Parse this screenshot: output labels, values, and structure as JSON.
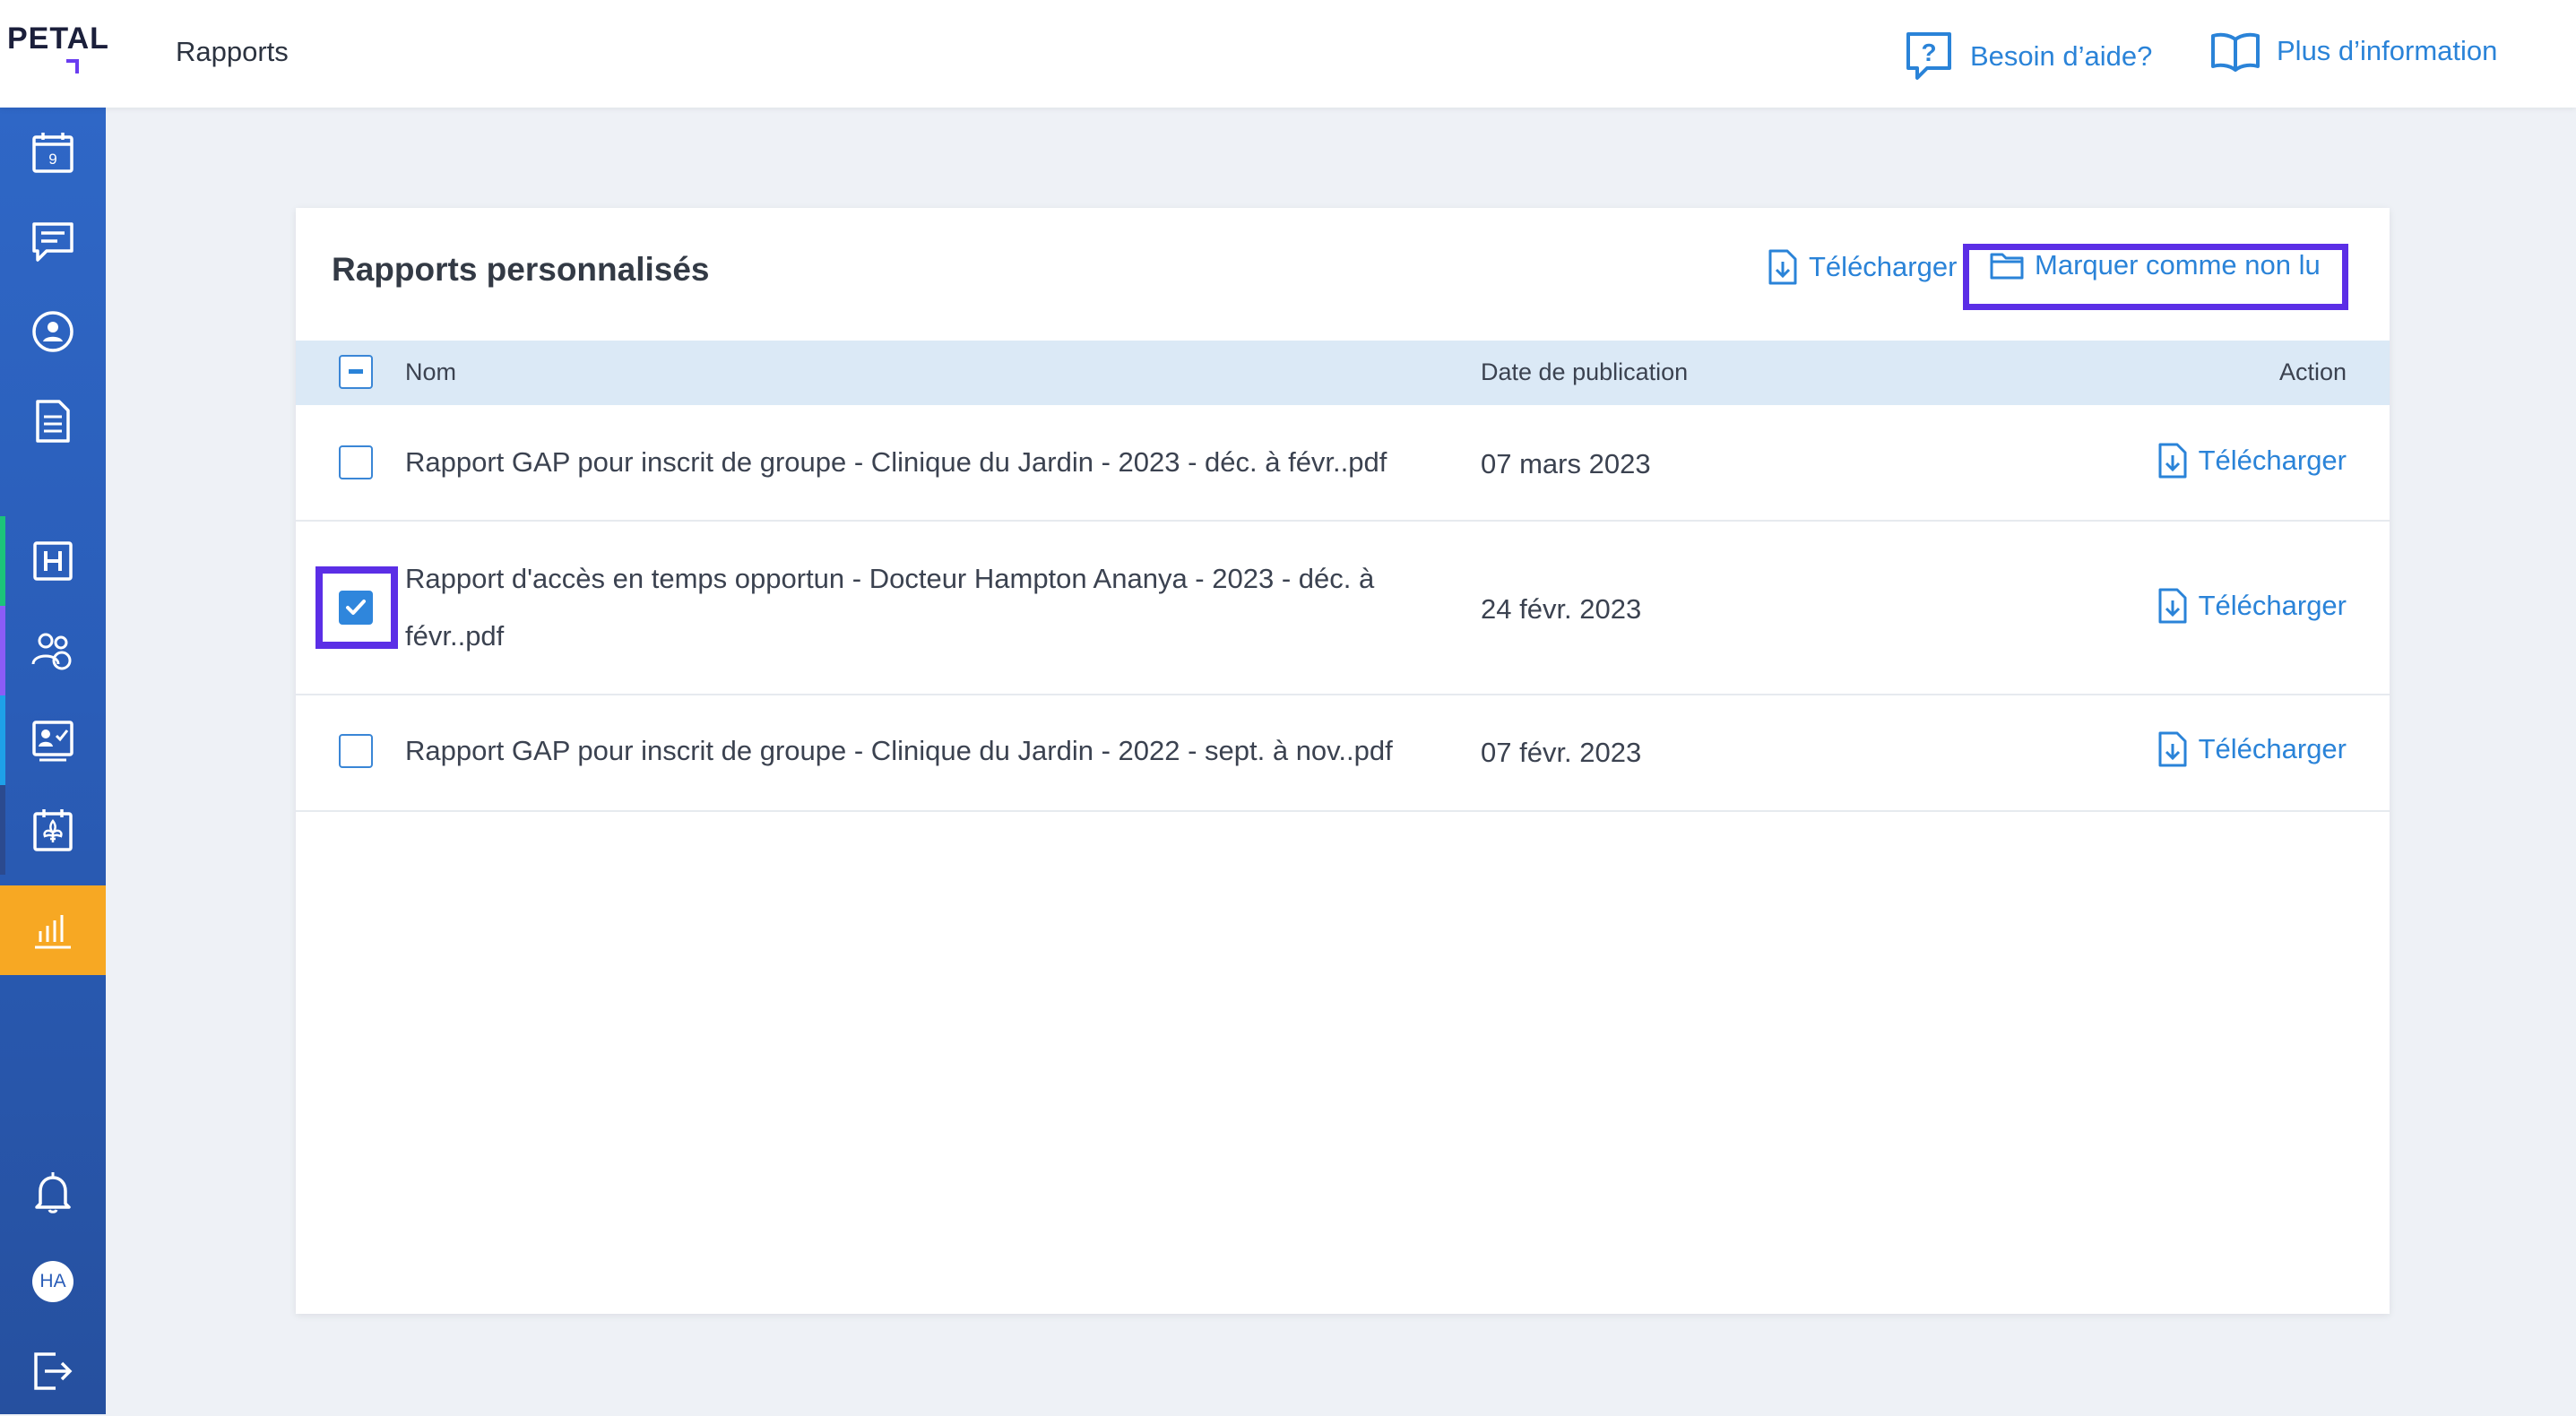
{
  "brand": {
    "logo_text": "PETAL"
  },
  "header": {
    "title": "Rapports",
    "help_label": "Besoin d’aide?",
    "info_label": "Plus d’information"
  },
  "sidebar": {
    "calendar_day": "9",
    "avatar_initials": "HA",
    "accent_colors": [
      "#1cc47a",
      "#8b5cf6",
      "#1ea1e8",
      "#2b4a8f"
    ],
    "active_color": "#f7a823"
  },
  "card": {
    "title": "Rapports personnalisés",
    "download_label": "Télécharger",
    "mark_unread_label": "Marquer comme non lu",
    "columns": {
      "name": "Nom",
      "date": "Date de publication",
      "action": "Action"
    },
    "rows": [
      {
        "name": "Rapport GAP pour inscrit de groupe - Clinique du Jardin - 2023 - déc. à févr..pdf",
        "date": "07 mars 2023",
        "action": "Télécharger",
        "checked": false
      },
      {
        "name_line1": "Rapport d'accès en temps opportun - Docteur Hampton Ananya - 2023 - déc. à",
        "name_line2": "févr..pdf",
        "date": "24 févr. 2023",
        "action": "Télécharger",
        "checked": true
      },
      {
        "name": "Rapport GAP pour inscrit de groupe - Clinique du Jardin - 2022 - sept. à nov..pdf",
        "date": "07 févr. 2023",
        "action": "Télécharger",
        "checked": false
      }
    ]
  },
  "colors": {
    "accent": "#2a83d8",
    "highlight": "#5b2ee6",
    "header_row": "#dbe9f6"
  }
}
